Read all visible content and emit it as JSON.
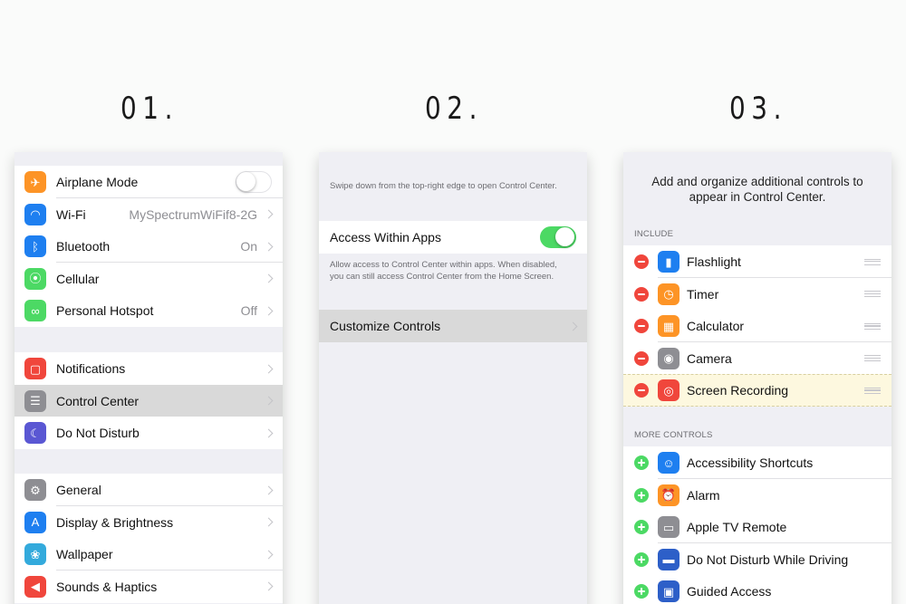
{
  "steps": [
    "01.",
    "02.",
    "03."
  ],
  "colors": {
    "toggle_on": "#4cd964",
    "remove": "#f0463c",
    "add": "#4cd964",
    "highlight_row": "#fdf8df"
  },
  "panel1": {
    "group1": [
      {
        "label": "Airplane Mode",
        "icon": "airplane-icon",
        "color": "#fd9426",
        "control": "toggle",
        "on": false
      },
      {
        "label": "Wi-Fi",
        "icon": "wifi-icon",
        "color": "#1e7ff0",
        "value": "MySpectrumWiFif8-2G"
      },
      {
        "label": "Bluetooth",
        "icon": "bluetooth-icon",
        "color": "#1e7ff0",
        "value": "On"
      },
      {
        "label": "Cellular",
        "icon": "cellular-icon",
        "color": "#4cd964"
      },
      {
        "label": "Personal Hotspot",
        "icon": "hotspot-icon",
        "color": "#4cd964",
        "value": "Off"
      }
    ],
    "group2": [
      {
        "label": "Notifications",
        "icon": "notifications-icon",
        "color": "#f0463c"
      },
      {
        "label": "Control Center",
        "icon": "control-center-icon",
        "color": "#8e8e93",
        "selected": true
      },
      {
        "label": "Do Not Disturb",
        "icon": "moon-icon",
        "color": "#5a57d3"
      }
    ],
    "group3": [
      {
        "label": "General",
        "icon": "gear-icon",
        "color": "#8e8e93"
      },
      {
        "label": "Display & Brightness",
        "icon": "display-icon",
        "color": "#1e7ff0"
      },
      {
        "label": "Wallpaper",
        "icon": "wallpaper-icon",
        "color": "#33aadc"
      },
      {
        "label": "Sounds & Haptics",
        "icon": "sound-icon",
        "color": "#f0463c"
      }
    ]
  },
  "panel2": {
    "intro": "Swipe down from the top-right edge to open Control Center.",
    "access_label": "Access Within Apps",
    "access_on": true,
    "access_note": "Allow access to Control Center within apps. When disabled, you can still access Control Center from the Home Screen.",
    "customize_label": "Customize Controls"
  },
  "panel3": {
    "intro": "Add and organize additional controls to appear in Control Center.",
    "include_header": "INCLUDE",
    "include": [
      {
        "label": "Flashlight",
        "icon": "flashlight-icon",
        "color": "#1e7ff0"
      },
      {
        "label": "Timer",
        "icon": "timer-icon",
        "color": "#fd9426"
      },
      {
        "label": "Calculator",
        "icon": "calculator-icon",
        "color": "#fd9426"
      },
      {
        "label": "Camera",
        "icon": "camera-icon",
        "color": "#8e8e93"
      },
      {
        "label": "Screen Recording",
        "icon": "screen-recording-icon",
        "color": "#f0463c",
        "highlight": true
      }
    ],
    "more_header": "MORE CONTROLS",
    "more": [
      {
        "label": "Accessibility Shortcuts",
        "icon": "accessibility-icon",
        "color": "#1e7ff0"
      },
      {
        "label": "Alarm",
        "icon": "alarm-icon",
        "color": "#fd9426"
      },
      {
        "label": "Apple TV Remote",
        "icon": "tv-remote-icon",
        "color": "#8e8e93"
      },
      {
        "label": "Do Not Disturb While Driving",
        "icon": "car-icon",
        "color": "#2d5fc8"
      },
      {
        "label": "Guided Access",
        "icon": "lock-icon",
        "color": "#2d5fc8"
      }
    ]
  }
}
